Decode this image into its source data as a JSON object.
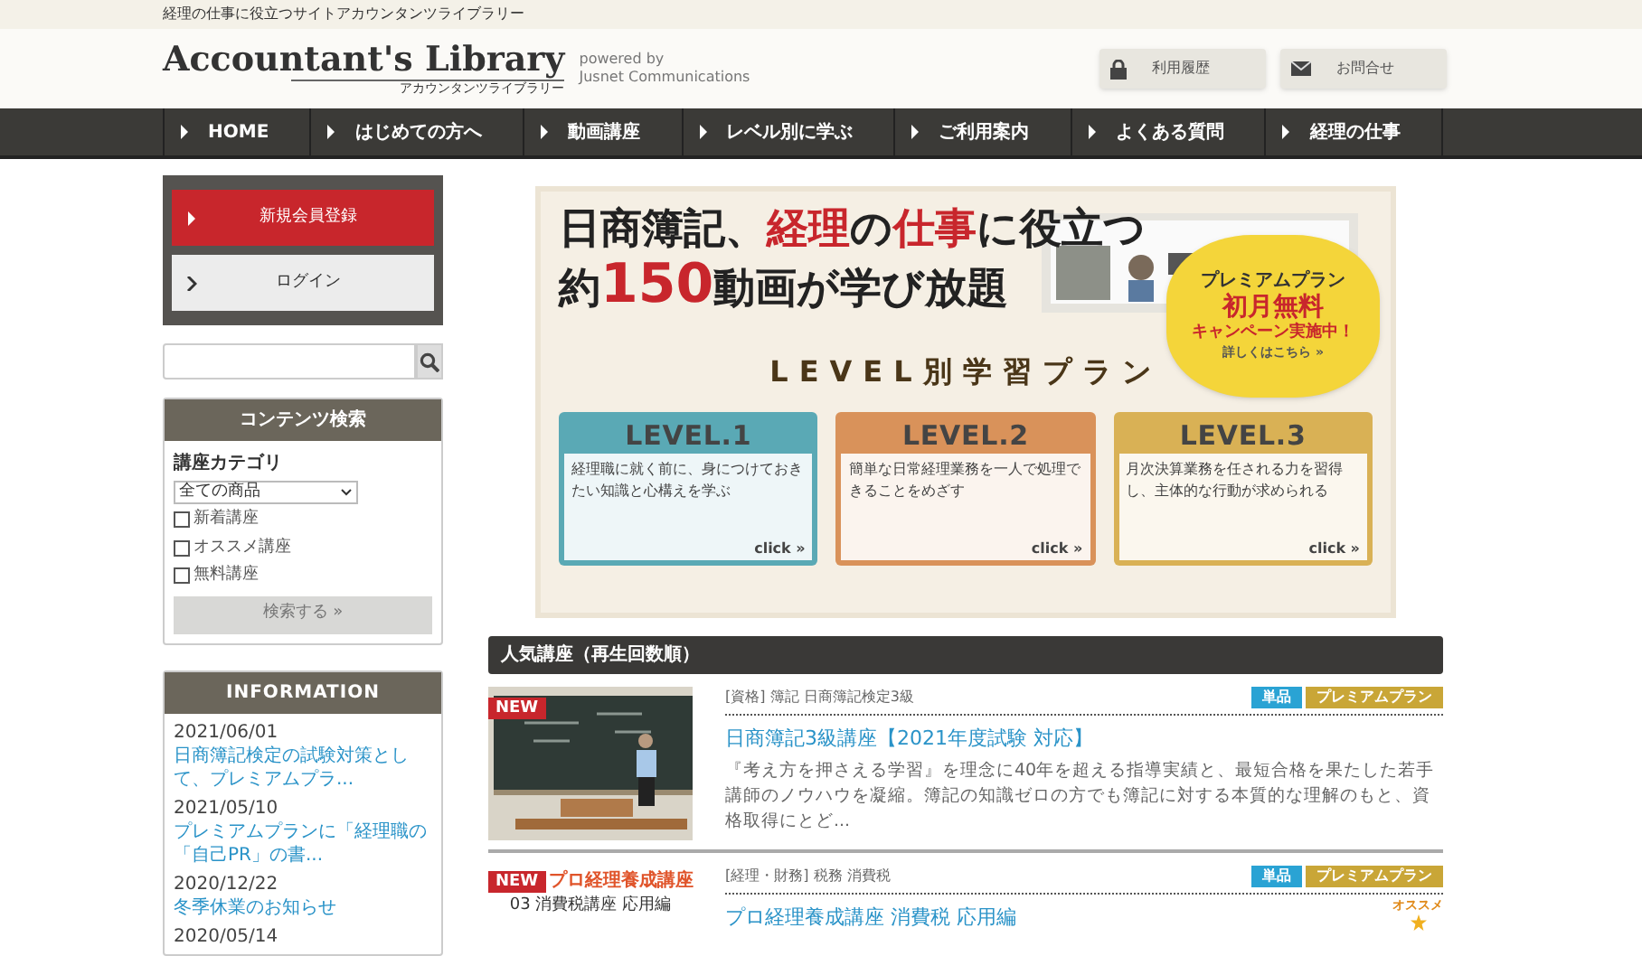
{
  "top_bar": {
    "tagline": "経理の仕事に役立つサイトアカウンタンツライブラリー"
  },
  "header": {
    "logo": "Accountant's Library",
    "logo_sub": "アカウンタンツライブラリー",
    "powered_by": "powered by",
    "company": "Jusnet Communications",
    "buttons": [
      "利用履歴",
      "お問合せ"
    ]
  },
  "nav": [
    "HOME",
    "はじめての方へ",
    "動画講座",
    "レベル別に学ぶ",
    "ご利用案内",
    "よくある質問",
    "経理の仕事"
  ],
  "sidebar": {
    "register": "新規会員登録",
    "login": "ログイン",
    "content_search": {
      "title": "コンテンツ検索",
      "category_label": "講座カテゴリ",
      "select_value": "全ての商品",
      "options": [
        {
          "label": "新着講座",
          "checked": false
        },
        {
          "label": "オススメ講座",
          "checked": false
        },
        {
          "label": "無料講座",
          "checked": false
        }
      ],
      "submit": "検索する »"
    },
    "information": {
      "title": "INFORMATION",
      "items": [
        {
          "date": "2021/06/01",
          "text": "日商簿記検定の試験対策として、プレミアムプラ..."
        },
        {
          "date": "2021/05/10",
          "text": "プレミアムプランに「経理職の「自己PR」の書..."
        },
        {
          "date": "2020/12/22",
          "text": "冬季休業のお知らせ"
        },
        {
          "date": "2020/05/14"
        }
      ]
    }
  },
  "banner": {
    "headline_1": "日商簿記、**経理**の**仕事**に役立つ",
    "headline_2_lead": "約",
    "headline_2_number": "150",
    "headline_2_rest": "動画が学び放題",
    "plan_title": "LEVEL別学習プラン",
    "promo": {
      "line_1": "プレミアムプラン",
      "line_2": "初月無料",
      "line_3": "キャンペーン実施中！",
      "link": "詳しくはこちら »"
    },
    "levels": [
      {
        "title": "LEVEL.1",
        "text": "経理職に就く前に、身につけておきたい知識と心構えを学ぶ",
        "link": "click »",
        "color": "#5aa9b5"
      },
      {
        "title": "LEVEL.2",
        "text": "簡単な日常経理業務を一人で処理できることをめざす",
        "link": "click »",
        "color": "#d9925a"
      },
      {
        "title": "LEVEL.3",
        "text": "月次決算業務を任される力を習得し、主体的な行動が求められる",
        "link": "click »",
        "color": "#d9b155"
      }
    ]
  },
  "popular": {
    "title": "人気講座（再生回数順）",
    "courses": [
      {
        "thumbnail": {
          "kind": "picture",
          "new_badge": "NEW"
        },
        "category": "[資格]",
        "tags": "簿記 日商簿記検定3級",
        "badges": [
          {
            "label": "単品",
            "color": "#2aa3d4"
          },
          {
            "label": "プレミアムプラン",
            "color": "#c9a637"
          }
        ],
        "title": "日商簿記3級講座【2021年度試験 対応】",
        "description": "『考え方を押さえる学習』を理念に40年を超える指導実績と、最短合格を果たした若手講師のノウハウを凝縮。簿記の知識ゼロの方でも簿記に対する本質的な理解のもと、資格取得にとど..."
      },
      {
        "thumbnail": {
          "kind": "graphic",
          "new_badge": "NEW",
          "title": "プロ経理養成講座",
          "subtitle": "03 消費税講座 応用編"
        },
        "category": "[経理・財務]",
        "tags": "税務 消費税",
        "badges": [
          {
            "label": "単品",
            "color": "#2aa3d4"
          },
          {
            "label": "プレミアムプラン",
            "color": "#c9a637"
          }
        ],
        "title": "プロ経理養成講座 消費税 応用編",
        "recommend": "オススメ"
      }
    ]
  }
}
